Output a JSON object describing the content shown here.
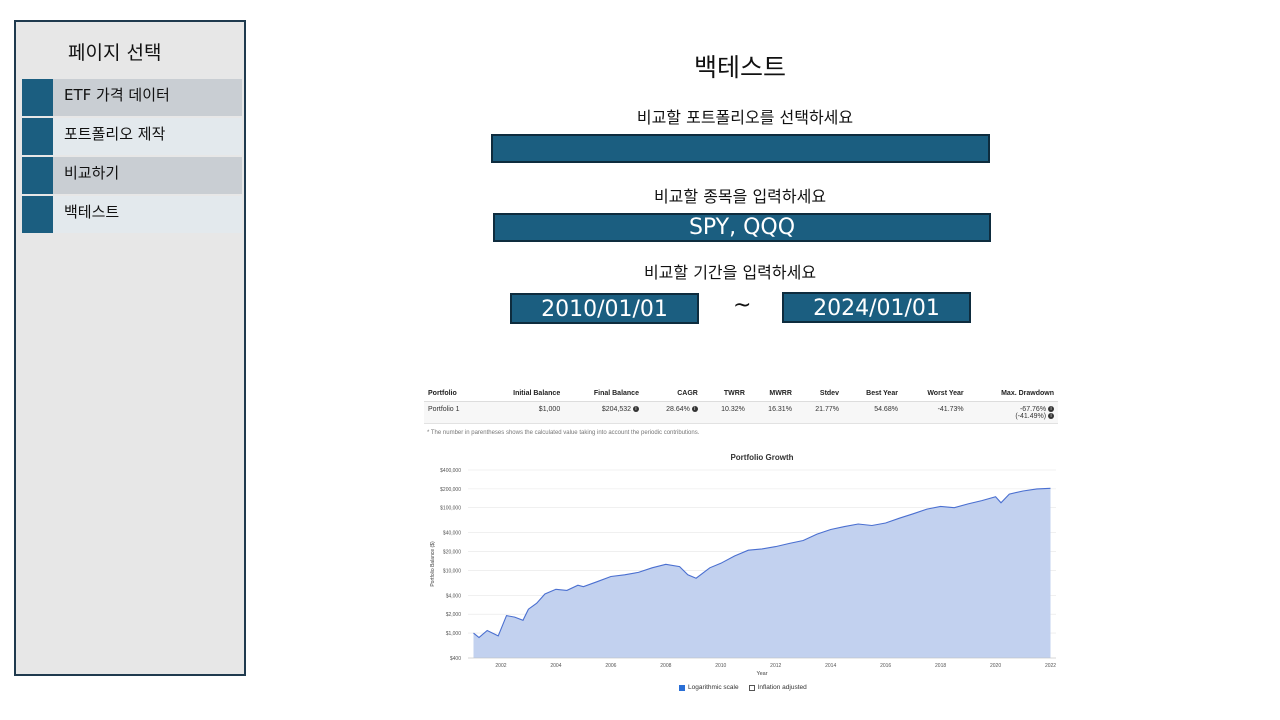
{
  "sidebar": {
    "title": "페이지 선택",
    "items": [
      {
        "label": "ETF 가격 데이터"
      },
      {
        "label": "포트폴리오 제작"
      },
      {
        "label": "비교하기"
      },
      {
        "label": "백테스트"
      }
    ]
  },
  "main": {
    "title": "백테스트",
    "portfolio_prompt": "비교할 포트폴리오를 선택하세요",
    "portfolio_value": "",
    "ticker_prompt": "비교할 종목을 입력하세요",
    "ticker_value": "SPY, QQQ",
    "period_prompt": "비교할 기간을 입력하세요",
    "start_date": "2010/01/01",
    "separator": "~",
    "end_date": "2024/01/01"
  },
  "results": {
    "headers": [
      "Portfolio",
      "Initial Balance",
      "Final Balance",
      "CAGR",
      "TWRR",
      "MWRR",
      "Stdev",
      "Best Year",
      "Worst Year",
      "Max. Drawdown"
    ],
    "row": {
      "portfolio": "Portfolio 1",
      "initial_balance": "$1,000",
      "final_balance": "$204,532",
      "cagr": "28.64%",
      "twrr": "10.32%",
      "mwrr": "16.31%",
      "stdev": "21.77%",
      "best_year": "54.68%",
      "worst_year": "-41.73%",
      "max_drawdown": "-67.76%",
      "max_drawdown_sub": "(-41.49%)"
    },
    "footnote": "* The number in parentheses shows the calculated value taking into account the periodic contributions.",
    "logarithmic_label": "Logarithmic scale",
    "logarithmic_checked": true,
    "inflation_label": "Inflation adjusted",
    "inflation_checked": false
  },
  "chart_data": {
    "type": "area",
    "title": "Portfolio Growth",
    "xlabel": "Year",
    "ylabel": "Portfolio Balance ($)",
    "yscale": "log",
    "ylim": [
      400,
      400000
    ],
    "xlim": [
      2000.8,
      2022.2
    ],
    "y_ticks": [
      400,
      1000,
      2000,
      4000,
      10000,
      20000,
      40000,
      100000,
      200000,
      400000
    ],
    "y_tick_labels": [
      "$400",
      "$1,000",
      "$2,000",
      "$4,000",
      "$10,000",
      "$20,000",
      "$40,000",
      "$100,000",
      "$200,000",
      "$400,000"
    ],
    "x_ticks": [
      2002,
      2004,
      2006,
      2008,
      2010,
      2012,
      2014,
      2016,
      2018,
      2020,
      2022
    ],
    "x_tick_labels": [
      "2002",
      "2004",
      "2006",
      "2008",
      "2010",
      "2012",
      "2014",
      "2016",
      "2018",
      "2020",
      "2022"
    ],
    "grid": true,
    "color": "#4a6fd0",
    "fill": "#c2d1ef",
    "series": [
      {
        "x": [
          2001.0,
          2001.2,
          2001.5,
          2001.9,
          2002.2,
          2002.5,
          2002.8,
          2003.0,
          2003.3,
          2003.6,
          2004.0,
          2004.4,
          2004.8,
          2005.0,
          2005.5,
          2006.0,
          2006.5,
          2007.0,
          2007.5,
          2008.0,
          2008.5,
          2008.8,
          2009.1,
          2009.6,
          2010.0,
          2010.5,
          2011.0,
          2011.5,
          2012.0,
          2012.5,
          2013.0,
          2013.5,
          2014.0,
          2014.5,
          2015.0,
          2015.5,
          2016.0,
          2016.5,
          2017.0,
          2017.5,
          2018.0,
          2018.5,
          2019.0,
          2019.5,
          2020.0,
          2020.2,
          2020.5,
          2021.0,
          2021.5,
          2022.0
        ],
        "values": [
          1000,
          850,
          1100,
          900,
          1900,
          1800,
          1600,
          2400,
          3000,
          4200,
          5000,
          4800,
          5800,
          5500,
          6600,
          8000,
          8500,
          9300,
          11000,
          12500,
          11500,
          8500,
          7500,
          11000,
          13000,
          17000,
          21000,
          22000,
          24000,
          27000,
          30000,
          38000,
          45000,
          50000,
          55000,
          52000,
          57000,
          68000,
          80000,
          95000,
          105000,
          100000,
          115000,
          130000,
          150000,
          120000,
          165000,
          185000,
          200000,
          204532
        ]
      }
    ]
  }
}
